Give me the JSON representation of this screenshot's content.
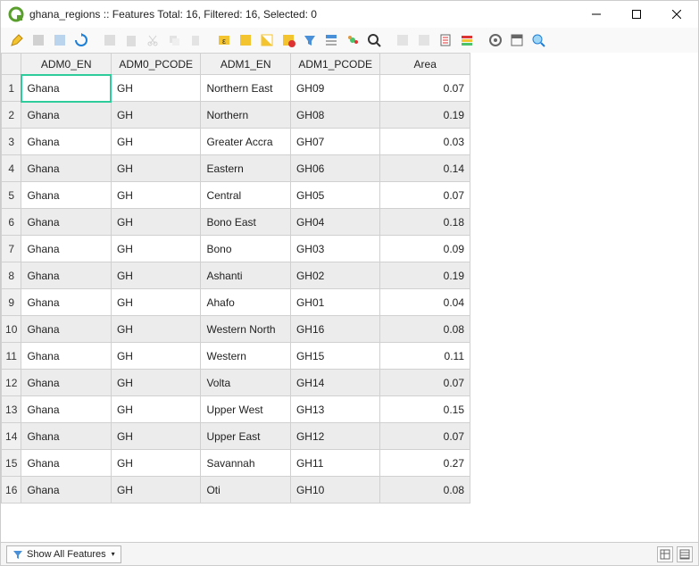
{
  "window": {
    "title": "ghana_regions :: Features Total: 16, Filtered: 16, Selected: 0"
  },
  "toolbar_icons": [
    "pencil-icon",
    "multi-edit-icon",
    "save-icon",
    "refresh-icon",
    "add-feature-icon",
    "delete-icon",
    "cut-icon",
    "copy-icon",
    "paste-icon",
    "expression-select-icon",
    "select-all-icon",
    "invert-selection-icon",
    "deselect-icon",
    "filter-icon",
    "move-top-icon",
    "pan-to-icon",
    "zoom-to-icon",
    "copy-cell-icon",
    "paste-cell-icon",
    "field-calc-icon",
    "conditional-format-icon",
    "actions-icon",
    "dock-icon",
    "identify-icon"
  ],
  "columns": [
    {
      "key": "adm0_en",
      "label": "ADM0_EN"
    },
    {
      "key": "adm0_pcode",
      "label": "ADM0_PCODE"
    },
    {
      "key": "adm1_en",
      "label": "ADM1_EN"
    },
    {
      "key": "adm1_pcode",
      "label": "ADM1_PCODE"
    },
    {
      "key": "area",
      "label": "Area"
    }
  ],
  "rows": [
    {
      "n": "1",
      "adm0_en": "Ghana",
      "adm0_pcode": "GH",
      "adm1_en": "Northern East",
      "adm1_pcode": "GH09",
      "area": "0.07"
    },
    {
      "n": "2",
      "adm0_en": "Ghana",
      "adm0_pcode": "GH",
      "adm1_en": "Northern",
      "adm1_pcode": "GH08",
      "area": "0.19"
    },
    {
      "n": "3",
      "adm0_en": "Ghana",
      "adm0_pcode": "GH",
      "adm1_en": "Greater Accra",
      "adm1_pcode": "GH07",
      "area": "0.03"
    },
    {
      "n": "4",
      "adm0_en": "Ghana",
      "adm0_pcode": "GH",
      "adm1_en": "Eastern",
      "adm1_pcode": "GH06",
      "area": "0.14"
    },
    {
      "n": "5",
      "adm0_en": "Ghana",
      "adm0_pcode": "GH",
      "adm1_en": "Central",
      "adm1_pcode": "GH05",
      "area": "0.07"
    },
    {
      "n": "6",
      "adm0_en": "Ghana",
      "adm0_pcode": "GH",
      "adm1_en": "Bono East",
      "adm1_pcode": "GH04",
      "area": "0.18"
    },
    {
      "n": "7",
      "adm0_en": "Ghana",
      "adm0_pcode": "GH",
      "adm1_en": "Bono",
      "adm1_pcode": "GH03",
      "area": "0.09"
    },
    {
      "n": "8",
      "adm0_en": "Ghana",
      "adm0_pcode": "GH",
      "adm1_en": "Ashanti",
      "adm1_pcode": "GH02",
      "area": "0.19"
    },
    {
      "n": "9",
      "adm0_en": "Ghana",
      "adm0_pcode": "GH",
      "adm1_en": "Ahafo",
      "adm1_pcode": "GH01",
      "area": "0.04"
    },
    {
      "n": "10",
      "adm0_en": "Ghana",
      "adm0_pcode": "GH",
      "adm1_en": "Western North",
      "adm1_pcode": "GH16",
      "area": "0.08"
    },
    {
      "n": "11",
      "adm0_en": "Ghana",
      "adm0_pcode": "GH",
      "adm1_en": "Western",
      "adm1_pcode": "GH15",
      "area": "0.11"
    },
    {
      "n": "12",
      "adm0_en": "Ghana",
      "adm0_pcode": "GH",
      "adm1_en": "Volta",
      "adm1_pcode": "GH14",
      "area": "0.07"
    },
    {
      "n": "13",
      "adm0_en": "Ghana",
      "adm0_pcode": "GH",
      "adm1_en": "Upper West",
      "adm1_pcode": "GH13",
      "area": "0.15"
    },
    {
      "n": "14",
      "adm0_en": "Ghana",
      "adm0_pcode": "GH",
      "adm1_en": "Upper East",
      "adm1_pcode": "GH12",
      "area": "0.07"
    },
    {
      "n": "15",
      "adm0_en": "Ghana",
      "adm0_pcode": "GH",
      "adm1_en": "Savannah",
      "adm1_pcode": "GH11",
      "area": "0.27"
    },
    {
      "n": "16",
      "adm0_en": "Ghana",
      "adm0_pcode": "GH",
      "adm1_en": "Oti",
      "adm1_pcode": "GH10",
      "area": "0.08"
    }
  ],
  "status": {
    "filter_label": "Show All Features"
  }
}
